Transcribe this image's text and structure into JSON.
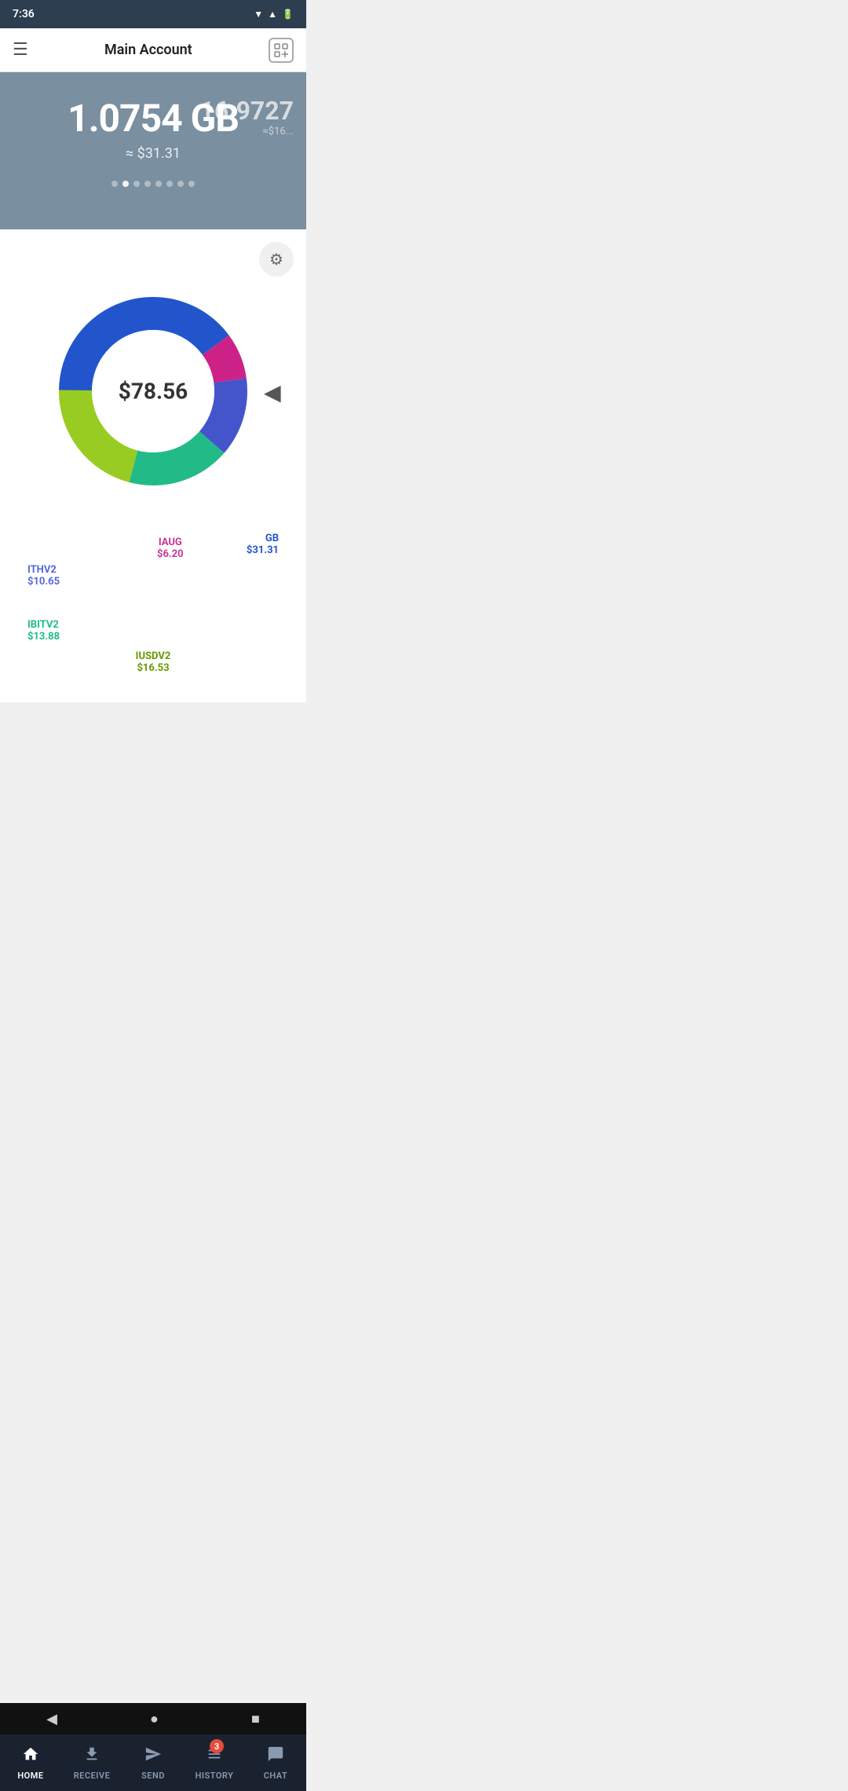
{
  "statusBar": {
    "time": "7:36"
  },
  "navbar": {
    "title": "Main Account",
    "menuIcon": "☰",
    "addIcon": "⊞"
  },
  "balance": {
    "primary": "1.0754 GB",
    "primaryUsd": "≈ $31.31",
    "secondary": "16.9727",
    "secondaryUsd": "≈$16..."
  },
  "carouselDots": [
    {
      "active": false
    },
    {
      "active": true
    },
    {
      "active": false
    },
    {
      "active": false
    },
    {
      "active": false
    },
    {
      "active": false
    },
    {
      "active": false
    },
    {
      "active": false
    }
  ],
  "chart": {
    "total": "$78.56",
    "settingsIcon": "⚙",
    "segments": [
      {
        "name": "GB",
        "value": "$31.31",
        "color": "#2255cc",
        "percentage": 39.9,
        "startAngle": -90,
        "endAngle": 54
      },
      {
        "name": "IAUG",
        "value": "$6.20",
        "color": "#cc2288",
        "percentage": 7.9,
        "startAngle": 54,
        "endAngle": 82
      },
      {
        "name": "ITHV2",
        "value": "$10.65",
        "color": "#4455cc",
        "percentage": 13.6,
        "startAngle": 82,
        "endAngle": 131
      },
      {
        "name": "IBITV2",
        "value": "$13.88",
        "color": "#22bb88",
        "percentage": 17.7,
        "startAngle": 131,
        "endAngle": 195
      },
      {
        "name": "IUSDV2",
        "value": "$16.53",
        "color": "#99cc22",
        "percentage": 21.1,
        "startAngle": 195,
        "endAngle": 270
      }
    ]
  },
  "bottomNav": {
    "items": [
      {
        "id": "home",
        "label": "HOME",
        "icon": "🏠",
        "active": true,
        "badge": null
      },
      {
        "id": "receive",
        "label": "RECEIVE",
        "icon": "⬇",
        "active": false,
        "badge": null
      },
      {
        "id": "send",
        "label": "SEND",
        "icon": "➤",
        "active": false,
        "badge": null
      },
      {
        "id": "history",
        "label": "HISTORY",
        "icon": "▤",
        "active": false,
        "badge": "3"
      },
      {
        "id": "chat",
        "label": "CHAT",
        "icon": "💬",
        "active": false,
        "badge": null
      }
    ]
  },
  "androidNav": {
    "back": "◀",
    "home": "●",
    "recent": "■"
  }
}
